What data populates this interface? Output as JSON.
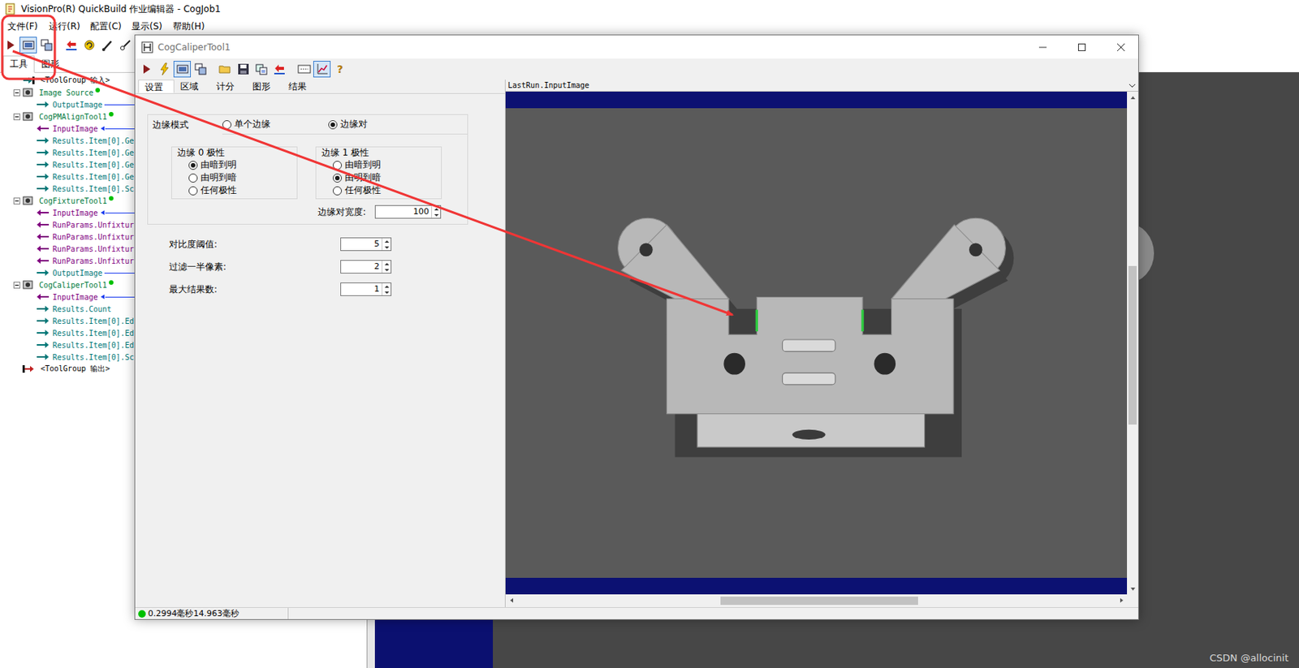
{
  "main_window": {
    "title": "VisionPro(R) QuickBuild 作业编辑器 - CogJob1",
    "menu": [
      "文件(F)",
      "运行(R)",
      "配置(C)",
      "显示(S)",
      "帮助(H)"
    ],
    "toolbar": [
      {
        "kind": "run",
        "pressed": false
      },
      {
        "kind": "display",
        "pressed": true
      },
      {
        "kind": "display2",
        "pressed": false
      },
      {
        "kind": "separator"
      },
      {
        "kind": "reset",
        "pressed": false
      },
      {
        "kind": "refresh",
        "pressed": false
      },
      {
        "kind": "brush",
        "pressed": false
      },
      {
        "kind": "cut",
        "pressed": false
      }
    ],
    "tabs": [
      {
        "label": "工具",
        "selected": true
      },
      {
        "label": "图形",
        "selected": false
      }
    ]
  },
  "tree": [
    {
      "label": "<ToolGroup 输入>",
      "kind": "group-in"
    },
    {
      "label": "Image Source",
      "kind": "tool",
      "expanded": true,
      "ok": true,
      "children": [
        {
          "label": "OutputImage",
          "kind": "output",
          "linked": true
        }
      ]
    },
    {
      "label": "CogPMAlignTool1",
      "kind": "tool",
      "expanded": true,
      "ok": true,
      "children": [
        {
          "label": "InputImage",
          "kind": "input",
          "linked": true
        },
        {
          "label": "Results.Item[0].Ge",
          "kind": "output",
          "linked": false
        },
        {
          "label": "Results.Item[0].Ge",
          "kind": "output",
          "linked": false
        },
        {
          "label": "Results.Item[0].Ge",
          "kind": "output",
          "linked": false
        },
        {
          "label": "Results.Item[0].Ge",
          "kind": "output",
          "linked": false
        },
        {
          "label": "Results.Item[0].Sc",
          "kind": "output",
          "linked": false
        }
      ]
    },
    {
      "label": "CogFixtureTool1",
      "kind": "tool",
      "expanded": true,
      "ok": true,
      "children": [
        {
          "label": "InputImage",
          "kind": "input",
          "linked": true
        },
        {
          "label": "RunParams.Unfixtur",
          "kind": "input",
          "linked": false
        },
        {
          "label": "RunParams.Unfixtur",
          "kind": "input",
          "linked": false
        },
        {
          "label": "RunParams.Unfixtur",
          "kind": "input",
          "linked": false
        },
        {
          "label": "RunParams.Unfixtur",
          "kind": "input",
          "linked": false
        },
        {
          "label": "OutputImage",
          "kind": "output",
          "linked": true
        }
      ]
    },
    {
      "label": "CogCaliperTool1",
      "kind": "tool",
      "expanded": true,
      "ok": true,
      "children": [
        {
          "label": "InputImage",
          "kind": "input",
          "linked": true
        },
        {
          "label": "Results.Count",
          "kind": "output",
          "linked": false
        },
        {
          "label": "Results.Item[0].Ed",
          "kind": "output",
          "linked": false
        },
        {
          "label": "Results.Item[0].Ed",
          "kind": "output",
          "linked": false
        },
        {
          "label": "Results.Item[0].Ed",
          "kind": "output",
          "linked": false
        },
        {
          "label": "Results.Item[0].Sc",
          "kind": "output",
          "linked": false
        }
      ]
    },
    {
      "label": "<ToolGroup 输出>",
      "kind": "group-out"
    }
  ],
  "caliper_window": {
    "title": "CogCaliperTool1",
    "toolbar": [
      {
        "kind": "run",
        "pressed": false
      },
      {
        "kind": "bolt",
        "pressed": false
      },
      {
        "kind": "display",
        "pressed": true
      },
      {
        "kind": "display2",
        "pressed": false
      },
      {
        "kind": "separator"
      },
      {
        "kind": "open",
        "pressed": false
      },
      {
        "kind": "save",
        "pressed": false
      },
      {
        "kind": "dup",
        "pressed": false
      },
      {
        "kind": "reset",
        "pressed": false
      },
      {
        "kind": "separator"
      },
      {
        "kind": "counter",
        "pressed": false
      },
      {
        "kind": "graph",
        "pressed": true
      },
      {
        "kind": "help",
        "pressed": false,
        "glyph": "?"
      }
    ],
    "tabs": [
      {
        "label": "设置",
        "selected": true
      },
      {
        "label": "区域",
        "selected": false
      },
      {
        "label": "计分",
        "selected": false
      },
      {
        "label": "图形",
        "selected": false
      },
      {
        "label": "结果",
        "selected": false
      }
    ],
    "settings": {
      "edge_mode": {
        "label": "边缘模式",
        "options": [
          {
            "label": "单个边缘",
            "selected": false
          },
          {
            "label": "边缘对",
            "selected": true
          }
        ]
      },
      "edge0": {
        "label": "边缘 0 极性",
        "options": [
          {
            "label": "由暗到明",
            "selected": true
          },
          {
            "label": "由明到暗",
            "selected": false
          },
          {
            "label": "任何极性",
            "selected": false
          }
        ]
      },
      "edge1": {
        "label": "边缘 1 极性",
        "options": [
          {
            "label": "由暗到明",
            "selected": false
          },
          {
            "label": "由明到暗",
            "selected": true
          },
          {
            "label": "任何极性",
            "selected": false
          }
        ]
      },
      "pair_width": {
        "label": "边缘对宽度:",
        "value": "100"
      },
      "fields": [
        {
          "label": "对比度阈值:",
          "value": "5"
        },
        {
          "label": "过滤一半像素:",
          "value": "2"
        },
        {
          "label": "最大结果数:",
          "value": "1"
        }
      ]
    },
    "image_view": {
      "label": "LastRun.InputImage",
      "hscroll": {
        "offset": 0.34,
        "size": 0.33
      },
      "vscroll": {
        "offset": 0.34,
        "size": 0.33
      }
    },
    "status": {
      "text": "0.2994毫秒14.963毫秒",
      "ok": true
    }
  },
  "watermark": "CSDN @allocinit"
}
